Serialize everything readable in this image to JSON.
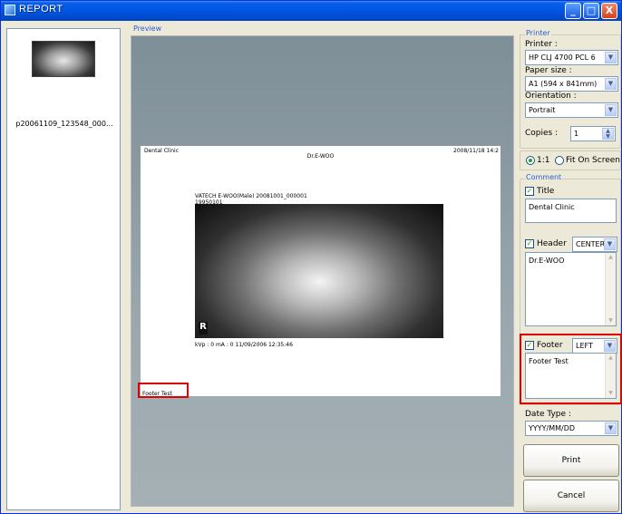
{
  "window": {
    "title": "REPORT",
    "controls": {
      "minimize": "_",
      "maximize": "□",
      "close": "X"
    }
  },
  "thumbnail": {
    "filename": "p20061109_123548_000..."
  },
  "preview": {
    "group_label": "Preview",
    "page": {
      "clinic": "Dental Clinic",
      "date": "2008/11/18 14:2",
      "doctor": "Dr.E-WOO",
      "patient_line1": "VATECH E-WOO(Male) 20081001_000001",
      "patient_line2": "19950101",
      "params": "kVp : 0     mA : 0     11/09/2006 12:35:46",
      "footer": "Footer Test",
      "r_mark": "R"
    }
  },
  "printer": {
    "group_label": "Printer",
    "printer_label": "Printer :",
    "printer_value": "HP CLJ 4700 PCL 6",
    "paper_label": "Paper size :",
    "paper_value": "A1 (594 x 841mm)",
    "orientation_label": "Orientation :",
    "orientation_value": "Portrait",
    "copies_label": "Copies :",
    "copies_value": "1"
  },
  "scale": {
    "option_1to1": "1:1",
    "option_fit": "Fit On Screen",
    "selected": "1:1"
  },
  "comment": {
    "group_label": "Comment",
    "title_label": "Title",
    "title_checked": true,
    "title_text": "Dental Clinic",
    "header_label": "Header",
    "header_checked": true,
    "header_align": "CENTER",
    "header_text": "Dr.E-WOO",
    "footer_label": "Footer",
    "footer_checked": true,
    "footer_align": "LEFT",
    "footer_text": "Footer Test"
  },
  "date_type": {
    "label": "Date Type :",
    "value": "YYYY/MM/DD"
  },
  "buttons": {
    "print": "Print",
    "cancel": "Cancel"
  },
  "colors": {
    "titlebar": "#0055e3",
    "highlight": "#e00000",
    "preview_bg": "#8e9ca4"
  }
}
